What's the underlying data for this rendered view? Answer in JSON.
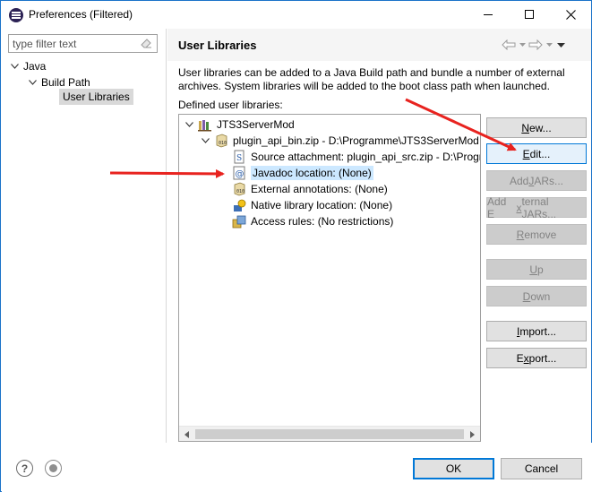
{
  "window": {
    "title": "Preferences (Filtered)"
  },
  "sidebar": {
    "filter_placeholder": "type filter text",
    "tree": [
      {
        "label": "Java",
        "level": 0,
        "expanded": true
      },
      {
        "label": "Build Path",
        "level": 1,
        "expanded": true
      },
      {
        "label": "User Libraries",
        "level": 2,
        "selected": true
      }
    ]
  },
  "page": {
    "title": "User Libraries",
    "description": "User libraries can be added to a Java Build path and bundle a number of external archives. System libraries will be added to the boot class path when launched.",
    "defined_label": "Defined user libraries:",
    "library_tree": [
      {
        "label": "JTS3ServerMod",
        "icon": "library-icon"
      },
      {
        "label": "plugin_api_bin.zip - D:\\Programme\\JTS3ServerMod",
        "icon": "jar-icon"
      },
      {
        "label": "Source attachment: plugin_api_src.zip - D:\\Progra",
        "icon": "source-attachment-icon"
      },
      {
        "label": "Javadoc location: (None)",
        "icon": "javadoc-icon",
        "selected": true
      },
      {
        "label": "External annotations: (None)",
        "icon": "annotations-icon"
      },
      {
        "label": "Native library location: (None)",
        "icon": "native-library-icon"
      },
      {
        "label": "Access rules: (No restrictions)",
        "icon": "access-rules-icon"
      }
    ]
  },
  "buttons": {
    "new": {
      "pre": "",
      "mn": "N",
      "post": "ew..."
    },
    "edit": {
      "pre": "",
      "mn": "E",
      "post": "dit..."
    },
    "add_jars": {
      "pre": "Add ",
      "mn": "J",
      "post": "ARs..."
    },
    "add_external_jars": {
      "pre": "Add E",
      "mn": "x",
      "post": "ternal JARs..."
    },
    "remove": {
      "pre": "",
      "mn": "R",
      "post": "emove"
    },
    "up": {
      "pre": "",
      "mn": "U",
      "post": "p"
    },
    "down": {
      "pre": "",
      "mn": "D",
      "post": "own"
    },
    "import": {
      "pre": "",
      "mn": "I",
      "post": "mport..."
    },
    "export": {
      "pre": "E",
      "mn": "x",
      "post": "port..."
    }
  },
  "footer": {
    "ok": "OK",
    "cancel": "Cancel"
  },
  "colors": {
    "selection": "#cce8ff",
    "focus_border": "#0078d7",
    "annotation_arrow": "#e8231f"
  }
}
